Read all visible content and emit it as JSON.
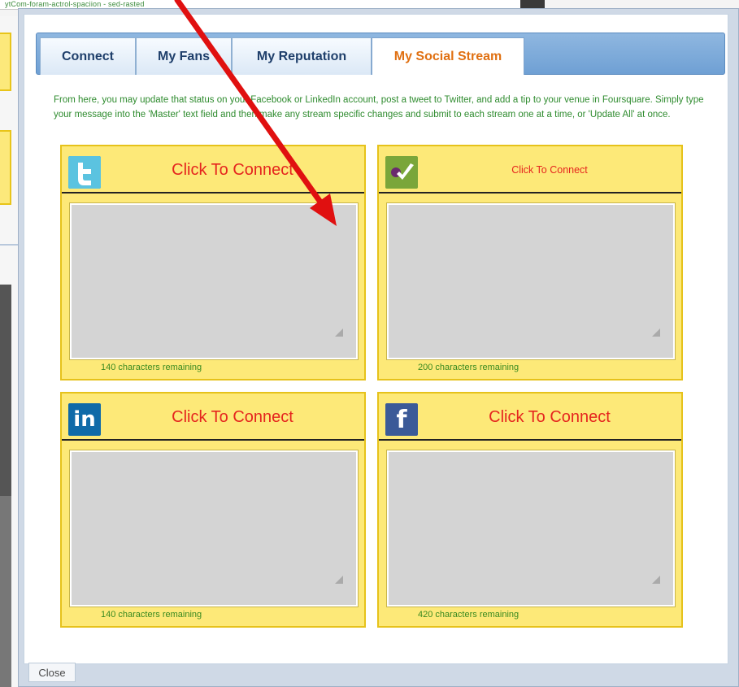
{
  "background": {
    "top_text": "ytCom-foram-actrol-spaciion - sed-rasted"
  },
  "tabs": [
    {
      "label": "Connect"
    },
    {
      "label": "My Fans"
    },
    {
      "label": "My Reputation"
    },
    {
      "label": "My Social Stream"
    }
  ],
  "intro_text": "From here, you may update that status on your Facebook or LinkedIn account, post a tweet to Twitter, and add a tip to your venue in Foursquare. Simply type your message into the 'Master' text field and then make any stream specific changes and submit to each stream one at a time, or 'Update All' at once.",
  "cards": [
    {
      "icon": "twitter-icon",
      "connect_label": "Click To Connect",
      "remaining": "140 characters remaining",
      "color": "#46b4d6"
    },
    {
      "icon": "foursquare-icon",
      "connect_label": "Click To Connect",
      "remaining": "200 characters remaining",
      "color": "#7aa63a"
    },
    {
      "icon": "linkedin-icon",
      "connect_label": "Click To Connect",
      "remaining": "140 characters remaining",
      "color": "#0f6aa8"
    },
    {
      "icon": "facebook-icon",
      "connect_label": "Click To Connect",
      "remaining": "420 characters remaining",
      "color": "#3b5a98"
    }
  ],
  "close_label": "Close",
  "colors": {
    "active_tab": "#e07012",
    "connect_text": "#e5251e",
    "card_bg": "#fde978",
    "arrow": "#e01010"
  }
}
